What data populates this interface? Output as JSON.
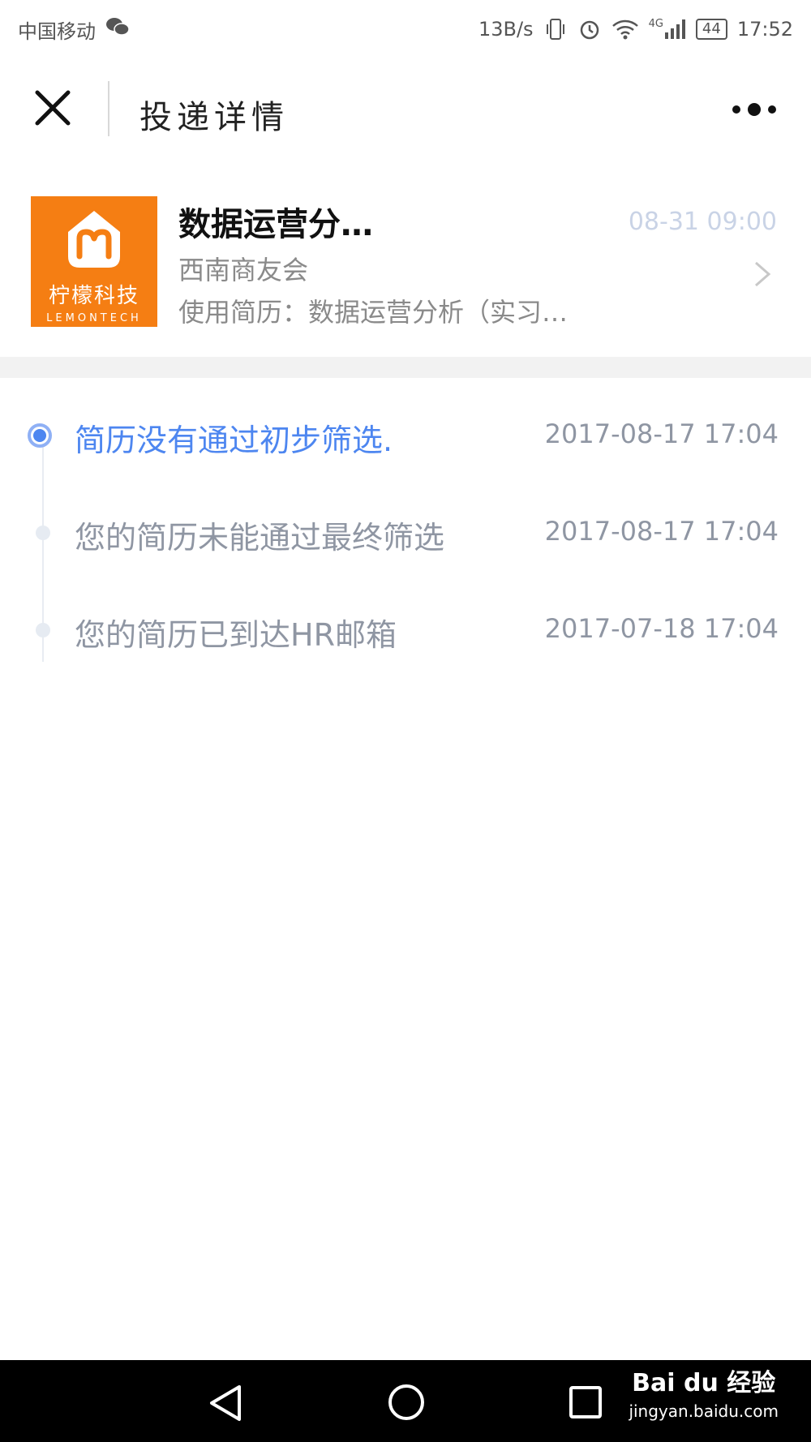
{
  "status_bar": {
    "carrier": "中国移动",
    "net_speed": "13B/s",
    "network": "4G",
    "battery": "44",
    "time": "17:52"
  },
  "header": {
    "title": "投递详情"
  },
  "job": {
    "logo_text": "柠檬科技",
    "logo_sub": "LEMONTECH",
    "title": "数据运营分…",
    "date_time": "08-31 09:00",
    "company": "西南商友会",
    "resume_used": "使用简历：数据运营分析（实习…"
  },
  "timeline": [
    {
      "text": "简历没有通过初步筛选.",
      "time": "2017-08-17 17:04",
      "active": true
    },
    {
      "text": "您的简历未能通过最终筛选",
      "time": "2017-08-17 17:04",
      "active": false
    },
    {
      "text": "您的简历已到达HR邮箱",
      "time": "2017-07-18 17:04",
      "active": false
    }
  ],
  "watermark": {
    "brand": "Bai du 经验",
    "url": "jingyan.baidu.com"
  },
  "colors": {
    "accent": "#4d86f0",
    "logo_bg": "#f57e13",
    "muted_text": "#8f96a3",
    "date_light": "#c9d3e6"
  }
}
